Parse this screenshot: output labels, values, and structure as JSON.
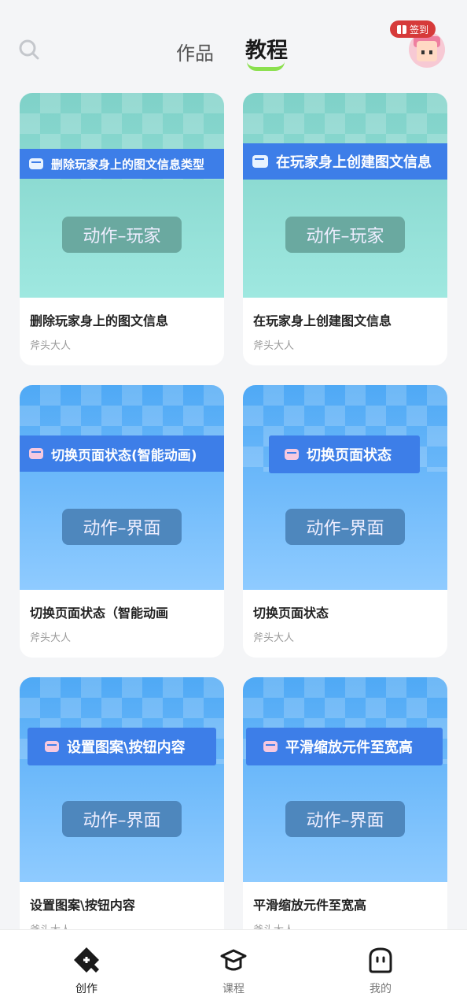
{
  "header": {
    "tabs": [
      "作品",
      "教程"
    ],
    "active_tab": "教程",
    "checkin_label": "签到"
  },
  "cards": [
    {
      "banner": "删除玩家身上的图文信息类型",
      "tag": "动作–玩家",
      "title": "删除玩家身上的图文信息",
      "author": "斧头大人"
    },
    {
      "banner": "在玩家身上创建图文信息",
      "tag": "动作–玩家",
      "title": "在玩家身上创建图文信息",
      "author": "斧头大人"
    },
    {
      "banner": "切换页面状态(智能动画)",
      "tag": "动作–界面",
      "title": "切换页面状态（智能动画",
      "author": "斧头大人"
    },
    {
      "banner": "切换页面状态",
      "tag": "动作–界面",
      "title": "切换页面状态",
      "author": "斧头大人"
    },
    {
      "banner": "设置图案\\按钮内容",
      "tag": "动作–界面",
      "title": "设置图案\\按钮内容",
      "author": "斧头大人"
    },
    {
      "banner": "平滑缩放元件至宽高",
      "tag": "动作–界面",
      "title": "平滑缩放元件至宽高",
      "author": "斧头大人"
    }
  ],
  "nav": [
    {
      "label": "创作",
      "icon": "create-icon",
      "active": true
    },
    {
      "label": "课程",
      "icon": "course-icon",
      "active": false
    },
    {
      "label": "我的",
      "icon": "profile-icon",
      "active": false
    }
  ],
  "colors": {
    "accent_green": "#8be04e",
    "banner_blue": "#3d7ee8",
    "checkin_red": "#d63a3a"
  }
}
